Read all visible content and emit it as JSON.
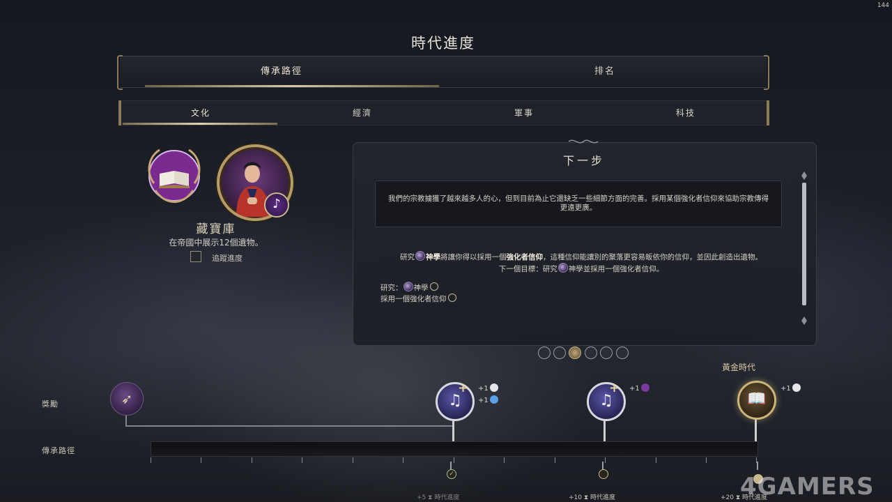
{
  "header": {
    "title": "時代進度",
    "corner_value": "144"
  },
  "main_tabs": [
    {
      "label": "傳承路徑",
      "active": true
    },
    {
      "label": "排名",
      "active": false
    }
  ],
  "sub_tabs": [
    {
      "label": "文化",
      "active": true
    },
    {
      "label": "經濟",
      "active": false
    },
    {
      "label": "軍事",
      "active": false
    },
    {
      "label": "科技",
      "active": false
    }
  ],
  "wonder": {
    "name": "藏寶庫",
    "description": "在帝國中展示12個遺物。",
    "track_label": "追蹤進度",
    "track_checked": false
  },
  "next_step": {
    "title": "下一步",
    "quote": "我們的宗教擄獲了越來越多人的心，但到目前為止它還缺乏一些細節方面的完善。採用某個強化者信仰來協助宗教傳得更遠更廣。",
    "line1_a": "研究",
    "line1_b": "神學",
    "line1_c": "將讓你得以採用一個",
    "line1_d": "強化者信仰",
    "line1_e": "，這種信仰能讓別的聚落更容易皈依你的信仰，並因此創造出遺物。",
    "line2_a": "下一個目標：研究",
    "line2_b": "神學並採用一個強化者信仰。",
    "req1_a": "研究：",
    "req1_b": "神學",
    "req2": "採用一個強化者信仰",
    "pages": 6,
    "active_page": 3
  },
  "track": {
    "rewards_label": "獎勵",
    "path_label": "傳承路徑",
    "golden_age_label": "黃金時代",
    "milestones": [
      {
        "bonus1": "+1",
        "bonus2": "+1"
      },
      {
        "bonus1": "+1"
      },
      {
        "bonus1": "+1"
      }
    ],
    "age_labels": [
      {
        "amount": "+5",
        "text": "時代進度"
      },
      {
        "amount": "+10",
        "text": "時代進度"
      },
      {
        "amount": "+20",
        "text": "時代進度"
      }
    ]
  },
  "watermark": "4GAMERS",
  "colors": {
    "accent_gold": "#c9b684",
    "purple": "#5b2c87",
    "panel": "#22252c"
  }
}
